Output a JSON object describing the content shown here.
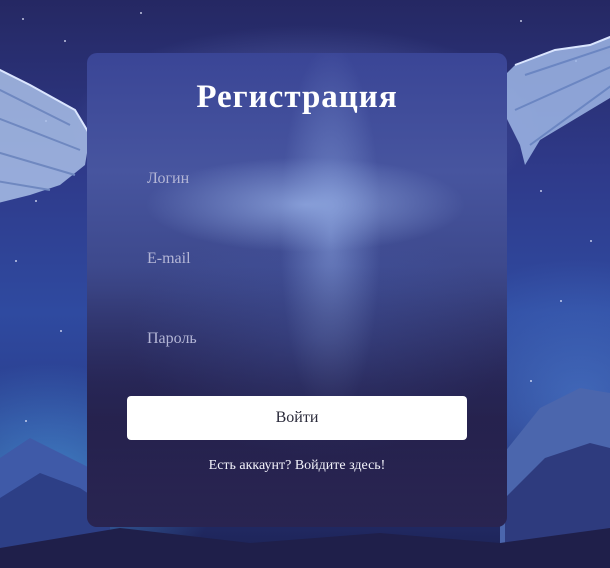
{
  "form": {
    "title": "Регистрация",
    "login_placeholder": "Логин",
    "email_placeholder": "E-mail",
    "password_placeholder": "Пароль",
    "submit_label": "Войти",
    "login_link": "Есть аккаунт? Войдите здесь!"
  },
  "theme": {
    "background": "#2f3a8a",
    "card_top": "#47559f",
    "card_bottom": "#2a2552",
    "button_bg": "#ffffff",
    "text_color": "#ffffff"
  }
}
